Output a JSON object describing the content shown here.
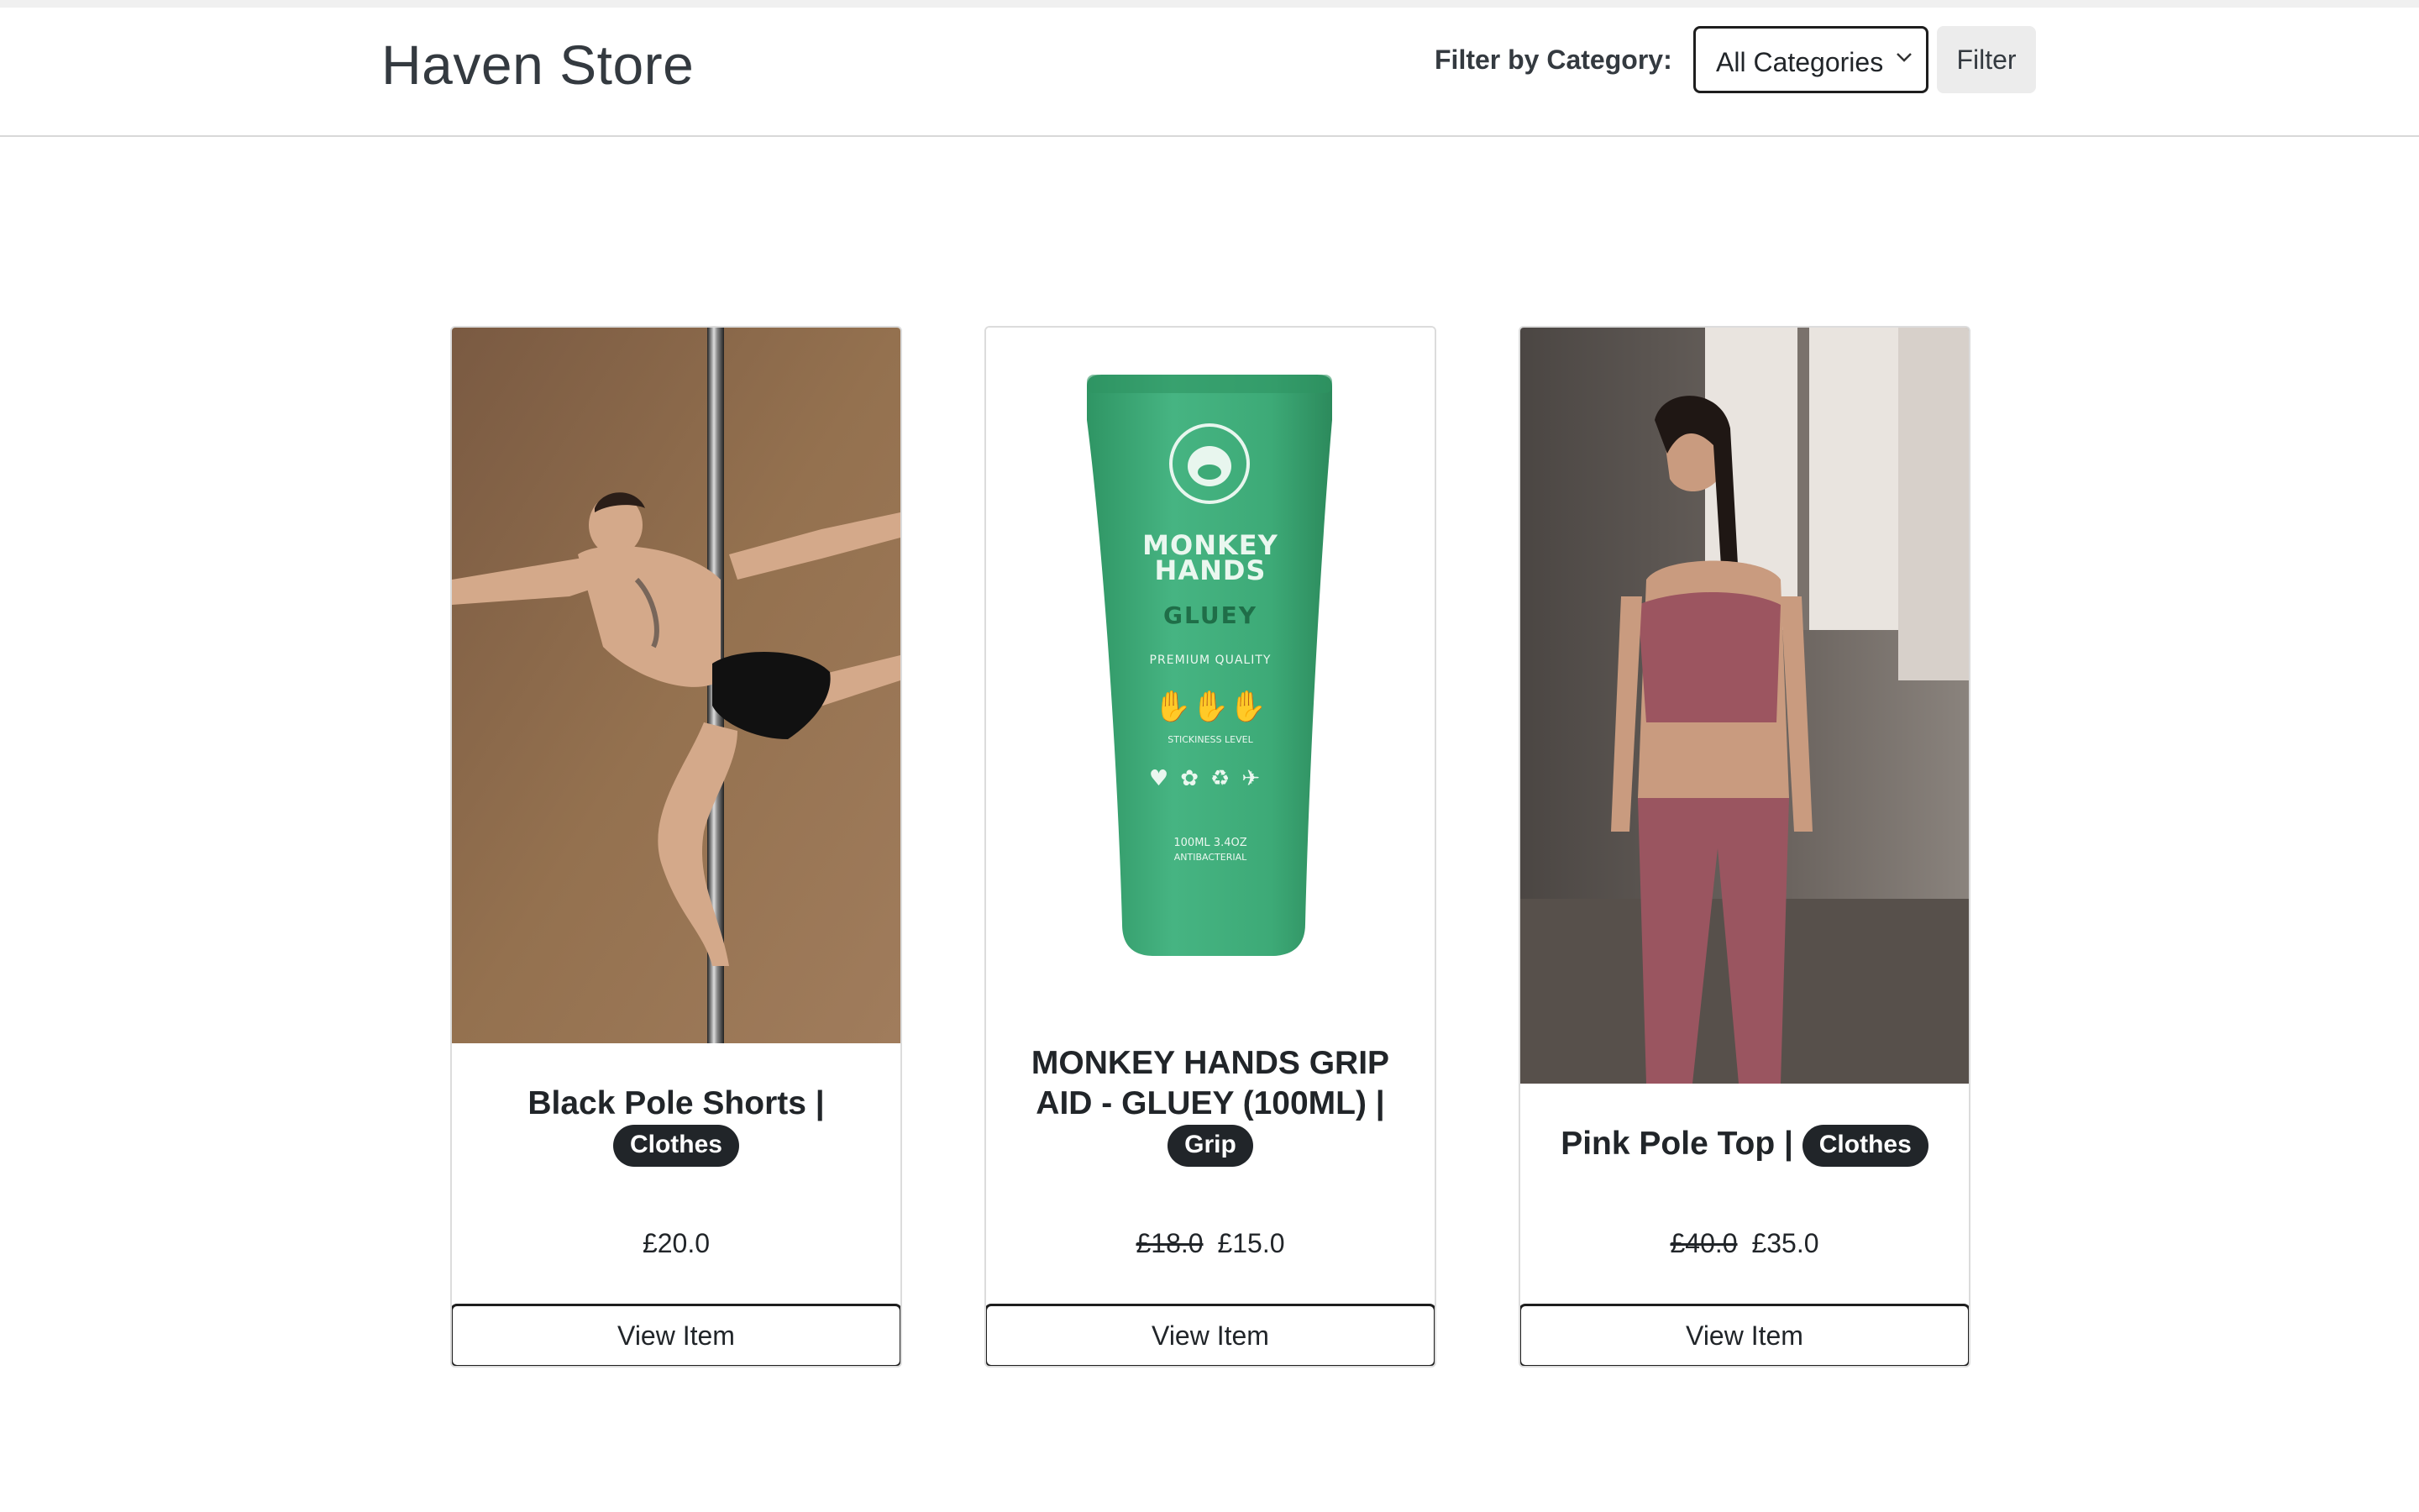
{
  "store": {
    "name": "Haven Store"
  },
  "filter": {
    "label": "Filter by Category:",
    "selected": "All Categories",
    "button_label": "Filter"
  },
  "products": [
    {
      "name": "Black Pole Shorts |",
      "category": "Clothes",
      "old_price": "",
      "price": "£20.0",
      "button_label": "View Item"
    },
    {
      "name": "MONKEY HANDS GRIP AID - GLUEY (100ML) |",
      "category": "Grip",
      "old_price": "£18.0",
      "price": "£15.0",
      "button_label": "View Item"
    },
    {
      "name": "Pink Pole Top |",
      "category": "Clothes",
      "old_price": "£40.0",
      "price": "£35.0",
      "button_label": "View Item"
    }
  ],
  "tube": {
    "brand_line1": "MONKEY",
    "brand_line2": "HANDS",
    "product": "GLUEY",
    "tagline": "PREMIUM QUALITY",
    "stickiness": "STICKINESS LEVEL",
    "volume": "100ML 3.4OZ",
    "note": "ANTIBACTERIAL"
  },
  "colors": {
    "badge": "#212529",
    "tube": "#3daa77",
    "photo1_bg": "#8d6a4e",
    "photo3_bg": "#5f5853"
  }
}
